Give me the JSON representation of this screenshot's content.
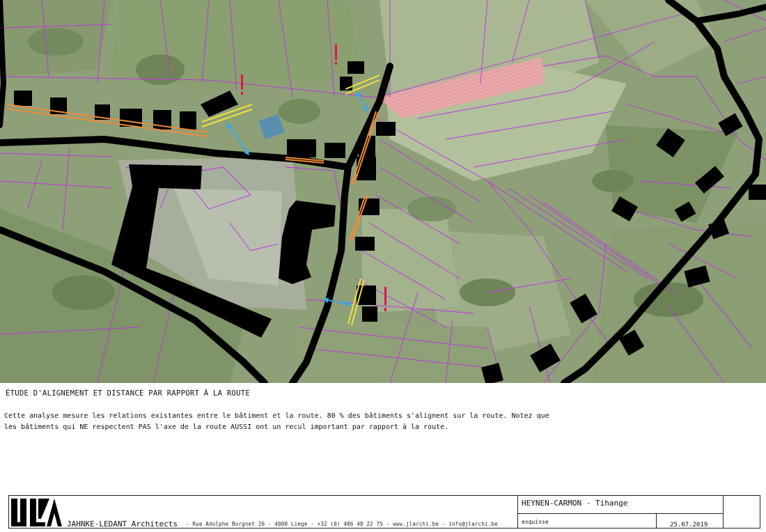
{
  "caption": {
    "title": "ÉTUDE D'ALIGNEMENT ET DISTANCE PAR RAPPORT À LA ROUTE",
    "body_line1": "Cette analyse mesure les relations existantes entre le bâtiment et la route.  80 % des bâtiments s'alignent sur la route.  Notez que",
    "body_line2": "les bâtiments qui NE respectent PAS l'axe de la route AUSSI ont un recul important par rapport à la route."
  },
  "titleblock": {
    "firm_name": "JAHNKE-LEDANT Architects",
    "firm_details": "-   Rue Adolphe Borgnet  26   -   4000  Liege   -   +32 (0) 486 48 22 75   -   www.jlarchi.be   -   info@jlarchi.be",
    "project_title": "HEYNEN-CARMON  - Tihange",
    "phase": "esquisse",
    "date": "25.07.2019"
  },
  "colors": {
    "aerial_base": "#8fa27a",
    "parcel_lines": "#c02ee8",
    "buildings": "#000000",
    "aligned_marker": "#ef8a3a",
    "non_aligned_marker": "#f2e23a",
    "distance_arrow": "#3aa8e6",
    "exclamation": "#e0154a",
    "highlighted_parcel": "#ef9aa4"
  },
  "icons": [
    "logo-jl",
    "exclamation-icon",
    "distance-arrow-icon"
  ]
}
